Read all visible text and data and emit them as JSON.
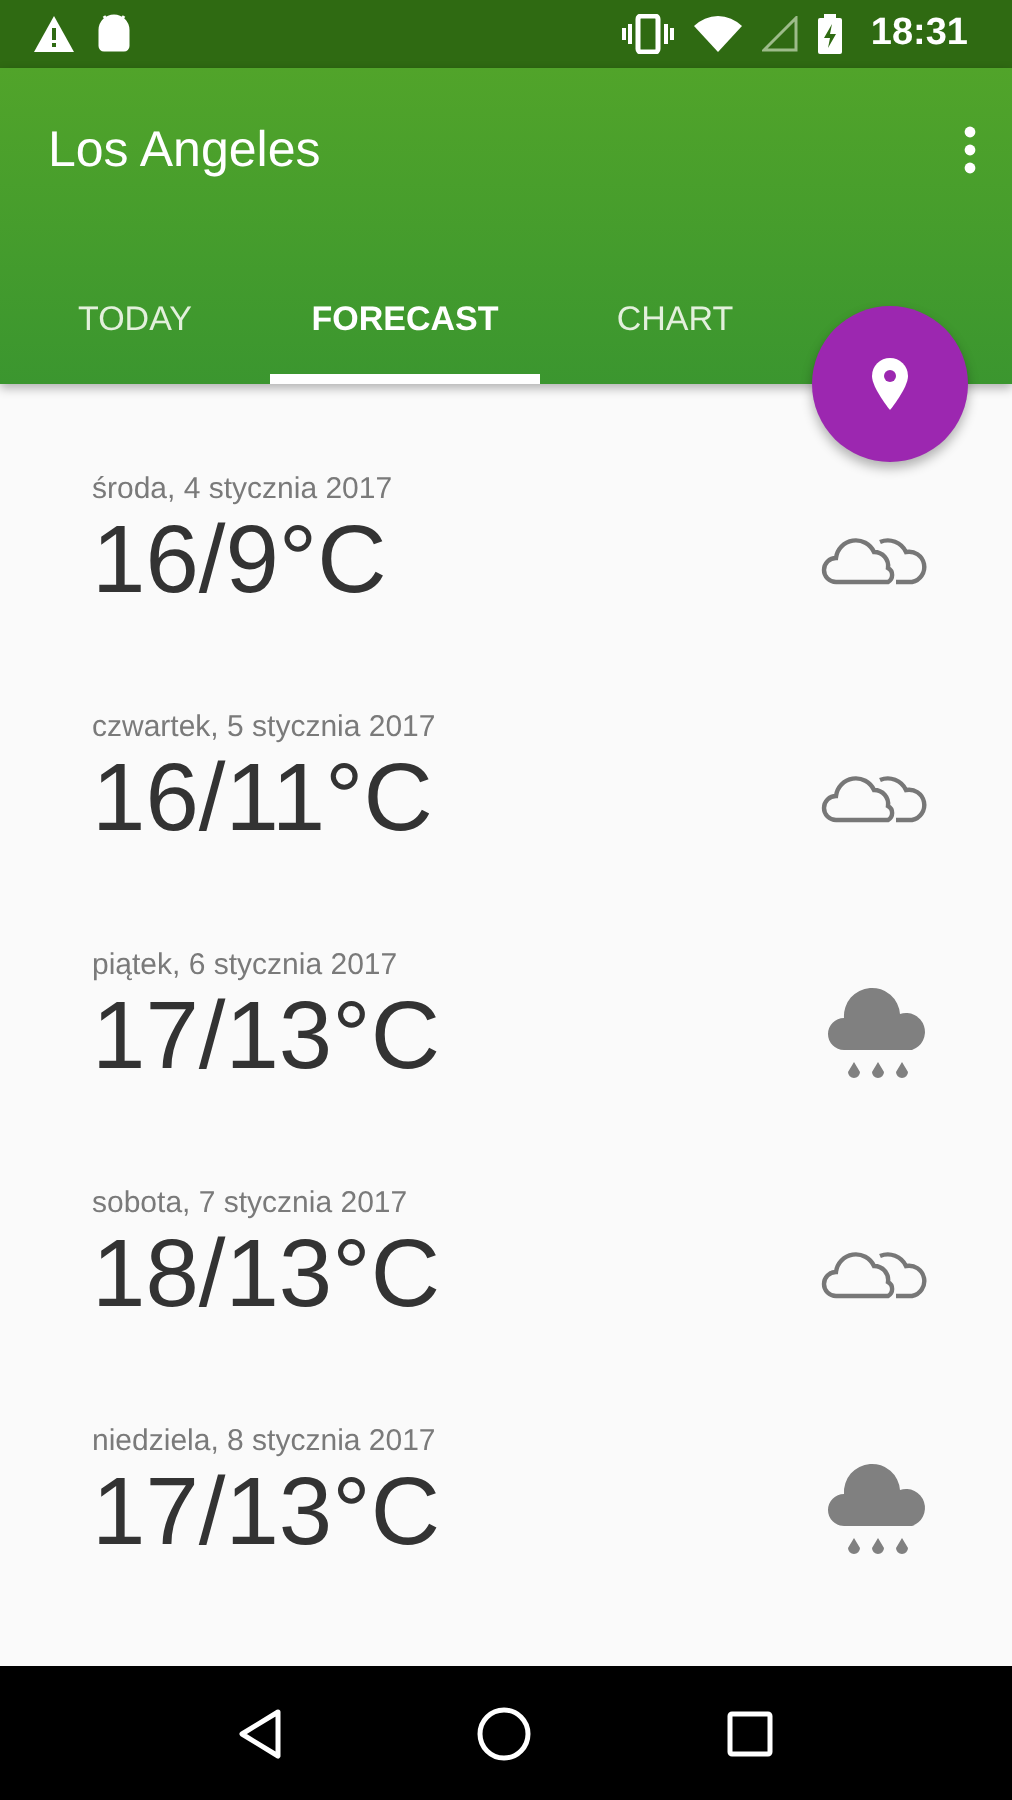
{
  "status_bar": {
    "time": "18:31"
  },
  "app_bar": {
    "title": "Los Angeles"
  },
  "tabs": [
    {
      "label": "TODAY",
      "selected": false
    },
    {
      "label": "FORECAST",
      "selected": true
    },
    {
      "label": "CHART",
      "selected": false
    }
  ],
  "forecast": [
    {
      "date": "środa, 4 stycznia 2017",
      "temperature": "16/9°C",
      "kind": "cloudy"
    },
    {
      "date": "czwartek, 5 stycznia 2017",
      "temperature": "16/11°C",
      "kind": "cloudy"
    },
    {
      "date": "piątek, 6 stycznia 2017",
      "temperature": "17/13°C",
      "kind": "rain"
    },
    {
      "date": "sobota, 7 stycznia 2017",
      "temperature": "18/13°C",
      "kind": "cloudy"
    },
    {
      "date": "niedziela, 8 stycznia 2017",
      "temperature": "17/13°C",
      "kind": "rain"
    }
  ]
}
